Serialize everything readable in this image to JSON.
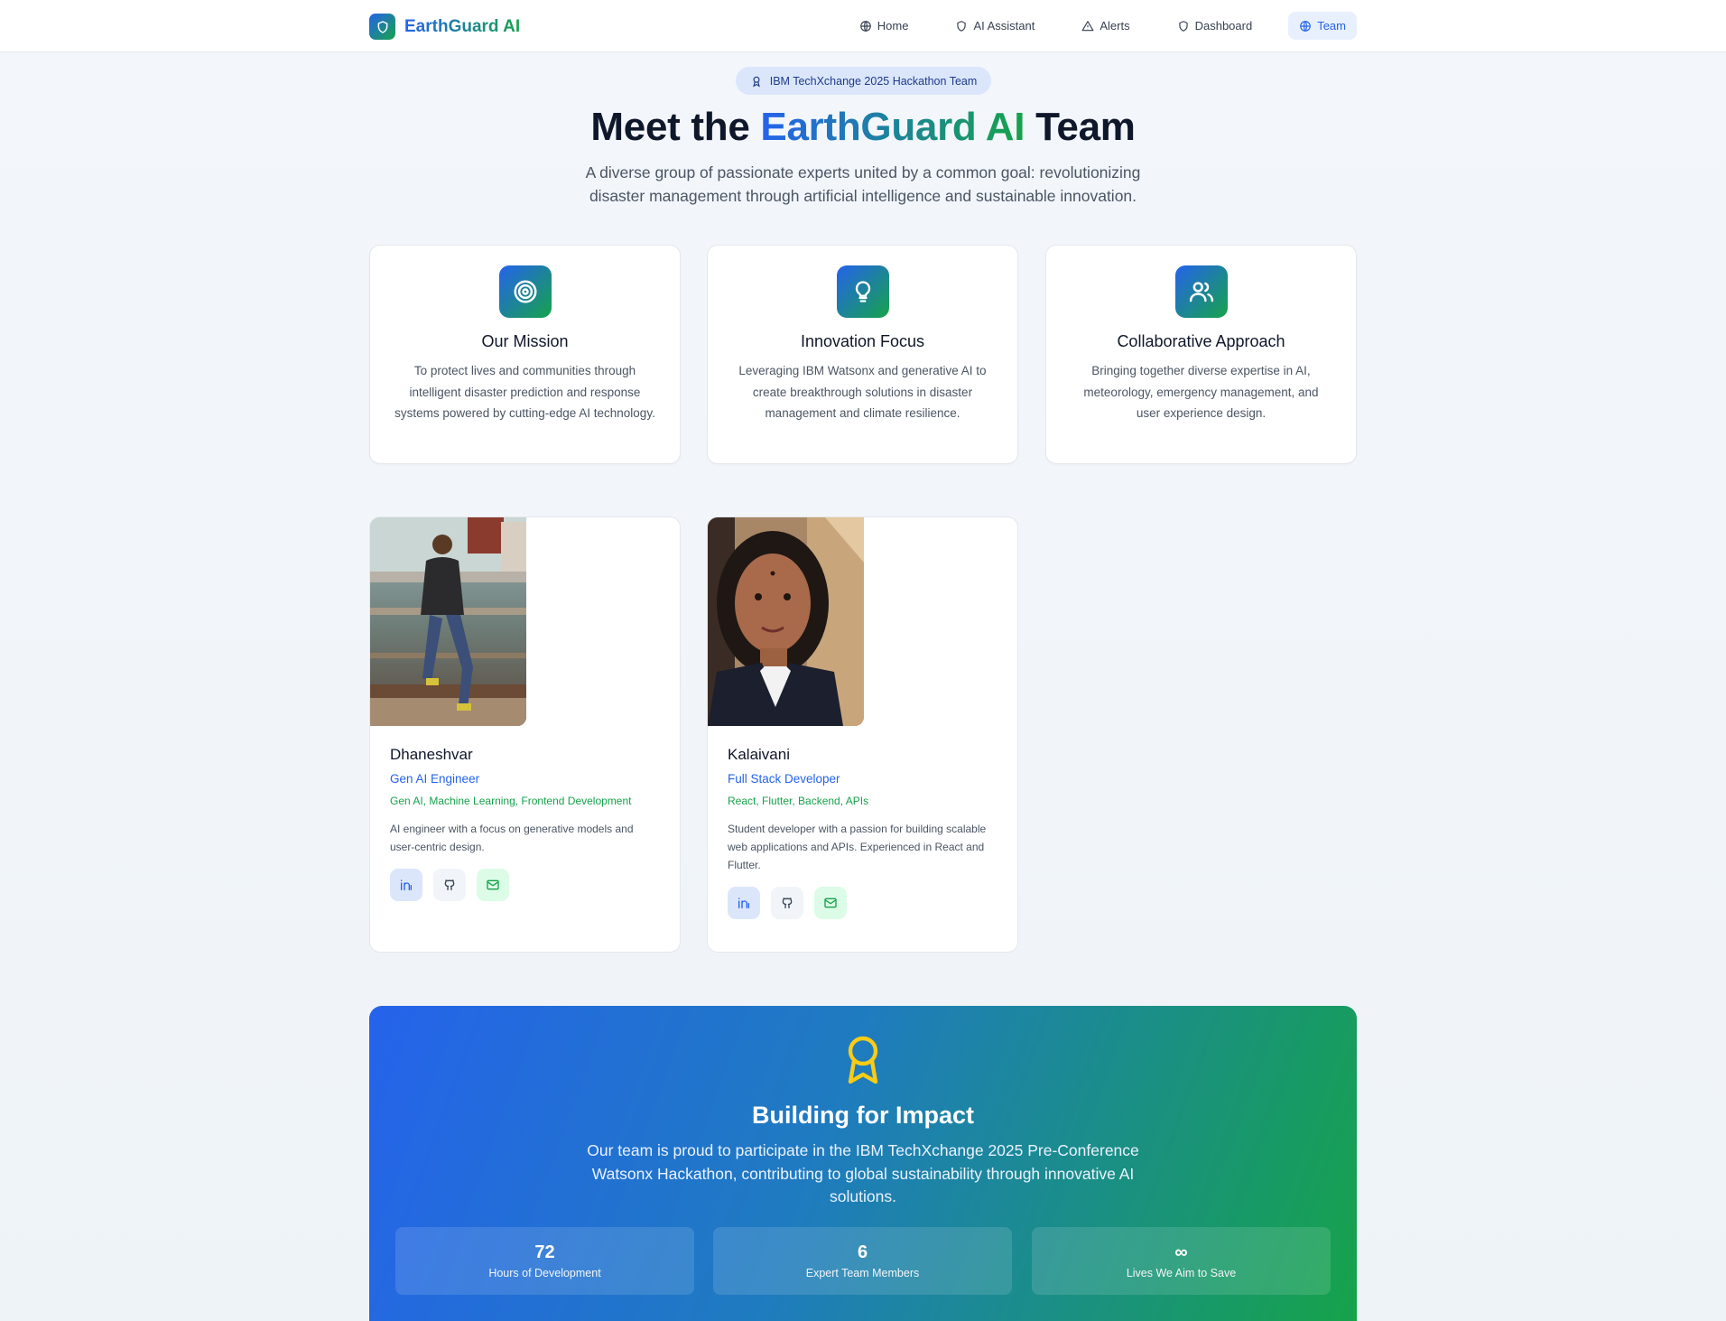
{
  "brand": {
    "name": "EarthGuard AI",
    "logo_icon": "shield-icon"
  },
  "nav": [
    {
      "label": "Home",
      "icon": "globe-icon",
      "active": false
    },
    {
      "label": "AI Assistant",
      "icon": "shield-icon",
      "active": false
    },
    {
      "label": "Alerts",
      "icon": "warning-triangle-icon",
      "active": false
    },
    {
      "label": "Dashboard",
      "icon": "shield-icon",
      "active": false
    },
    {
      "label": "Team",
      "icon": "globe-icon",
      "active": true
    }
  ],
  "hero": {
    "badge": "IBM TechXchange 2025 Hackathon Team",
    "title_prefix": "Meet the ",
    "title_highlight": "EarthGuard AI",
    "title_suffix": " Team",
    "subtitle": "A diverse group of passionate experts united by a common goal: revolutionizing disaster management through artificial intelligence and sustainable innovation."
  },
  "features": [
    {
      "icon": "target-icon",
      "title": "Our Mission",
      "text": "To protect lives and communities through intelligent disaster prediction and response systems powered by cutting-edge AI technology."
    },
    {
      "icon": "lightbulb-icon",
      "title": "Innovation Focus",
      "text": "Leveraging IBM Watsonx and generative AI to create breakthrough solutions in disaster management and climate resilience."
    },
    {
      "icon": "users-icon",
      "title": "Collaborative Approach",
      "text": "Bringing together diverse expertise in AI, meteorology, emergency management, and user experience design."
    }
  ],
  "team": [
    {
      "name": "Dhaneshvar",
      "role": "Gen AI Engineer",
      "skills": "Gen AI, Machine Learning, Frontend Development",
      "bio": "AI engineer with a focus on generative models and user-centric design."
    },
    {
      "name": "Kalaivani",
      "role": "Full Stack Developer",
      "skills": "React, Flutter, Backend, APIs",
      "bio": "Student developer with a passion for building scalable web applications and APIs. Experienced in React and Flutter."
    }
  ],
  "impact": {
    "icon": "award-icon",
    "title": "Building for Impact",
    "text": "Our team is proud to participate in the IBM TechXchange 2025 Pre-Conference Watsonx Hackathon, contributing to global sustainability through innovative AI solutions.",
    "stats": [
      {
        "value": "72",
        "label": "Hours of Development"
      },
      {
        "value": "6",
        "label": "Expert Team Members"
      },
      {
        "value": "∞",
        "label": "Lives We Aim to Save"
      }
    ]
  },
  "colors": {
    "blue": "#2563eb",
    "green": "#16a34a",
    "text": "#0f172a",
    "muted": "#4b5563"
  }
}
